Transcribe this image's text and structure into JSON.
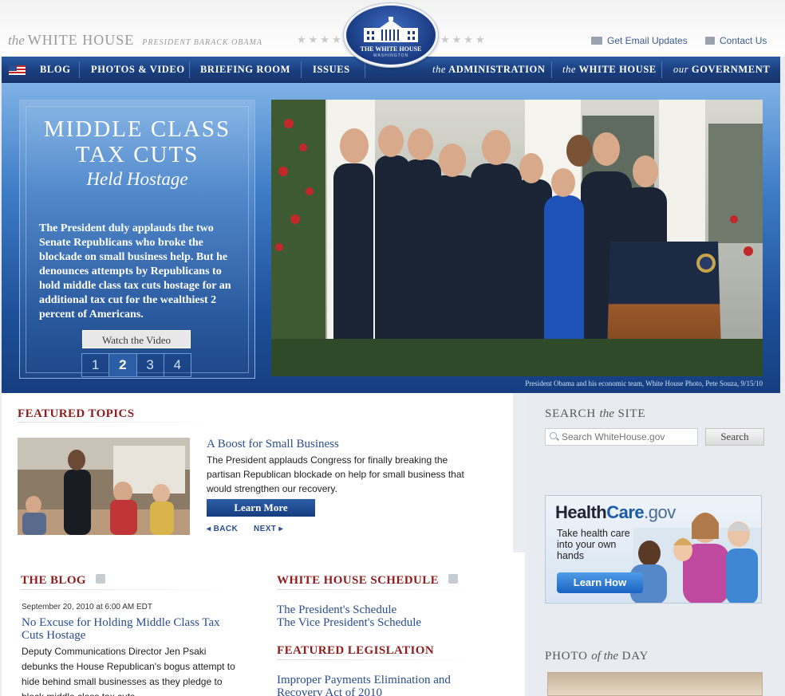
{
  "header": {
    "brand_the": "the",
    "brand_name": "WHITE HOUSE",
    "brand_president": "PRESIDENT BARACK OBAMA",
    "seal_title": "THE WHITE HOUSE",
    "seal_subtitle": "WASHINGTON",
    "email_link": "Get Email Updates",
    "contact_link": "Contact Us"
  },
  "nav": {
    "blog": "BLOG",
    "photos": "PHOTOS & VIDEO",
    "briefing": "BRIEFING ROOM",
    "issues": "ISSUES",
    "admin_the": "the",
    "admin": "ADMINISTRATION",
    "wh_the": "the",
    "wh": "WHITE HOUSE",
    "gov_our": "our",
    "gov": "GOVERNMENT"
  },
  "hero": {
    "title_line1": "MIDDLE CLASS",
    "title_line2": "TAX CUTS",
    "title_line3": "Held Hostage",
    "text": "The President duly applauds the two Senate Republicans who broke the blockade on small business help. But he denounces attempts by Republicans to hold middle class tax cuts hostage for an additional tax cut for the wealthiest 2 percent of Americans.",
    "watch_label": "Watch the Video",
    "pages": [
      "1",
      "2",
      "3",
      "4"
    ],
    "active_page": 2,
    "caption": "President Obama and his economic team, White House Photo, Pete Souza, 9/15/10"
  },
  "featured": {
    "heading": "FEATURED TOPICS",
    "title": "A Boost for Small Business",
    "description": "The President applauds Congress for finally breaking the partisan Republican blockade on help for small business that would strengthen our recovery.",
    "learn_more": "Learn More",
    "back": "BACK",
    "next": "NEXT"
  },
  "blog": {
    "heading": "THE BLOG",
    "date": "September 20, 2010 at 6:00 AM EDT",
    "post_title": "No Excuse for Holding Middle Class Tax Cuts Hostage",
    "post_text": "Deputy Communications Director Jen Psaki debunks the House Republican's bogus attempt to hide behind small businesses as they pledge to block middle class tax cuts."
  },
  "schedule": {
    "heading": "WHITE HOUSE SCHEDULE",
    "president": "The President's Schedule",
    "vice_president": "The Vice President's Schedule"
  },
  "legislation": {
    "heading": "FEATURED LEGISLATION",
    "item": "Improper Payments Elimination and Recovery Act of 2010"
  },
  "sidebar": {
    "search_heading": "SEARCH",
    "search_heading_the": "the",
    "search_heading_site": "SITE",
    "search_placeholder": "Search WhiteHouse.gov",
    "search_button": "Search",
    "healthcare_health": "Health",
    "healthcare_care": "Care",
    "healthcare_gov": ".gov",
    "healthcare_text": "Take health care into your own hands",
    "healthcare_button": "Learn How",
    "photo_heading_photo": "PHOTO",
    "photo_heading_of": "of the",
    "photo_heading_day": "DAY"
  }
}
